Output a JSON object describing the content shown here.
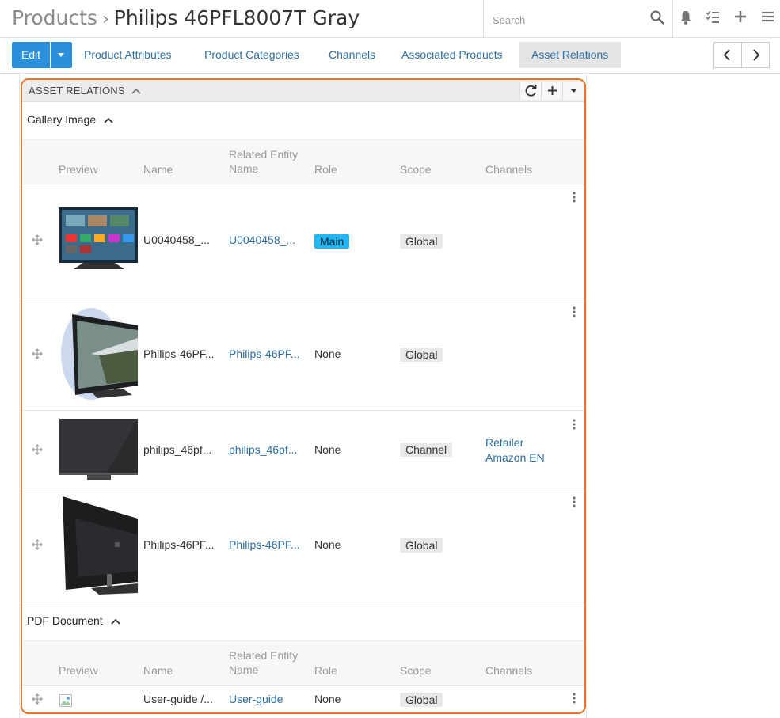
{
  "header": {
    "crumb": "Products",
    "separator": "›",
    "title": "Philips 46PFL8007T Gray",
    "search_placeholder": "Search"
  },
  "toolbar": {
    "edit_label": "Edit",
    "tabs": [
      {
        "label": "Product Attributes"
      },
      {
        "label": "Product Categories"
      },
      {
        "label": "Channels"
      },
      {
        "label": "Associated Products"
      },
      {
        "label": "Asset Relations"
      }
    ]
  },
  "panel": {
    "title": "ASSET RELATIONS",
    "columns": {
      "preview": "Preview",
      "name": "Name",
      "related": "Related Entity Name",
      "role": "Role",
      "scope": "Scope",
      "channels": "Channels"
    },
    "gallery": {
      "title": "Gallery Image",
      "rows": [
        {
          "name": "U0040458_...",
          "related": "U0040458_...",
          "role": "Main",
          "scope": "Global",
          "channels": ""
        },
        {
          "name": "Philips-46PF...",
          "related": "Philips-46PF...",
          "role": "None",
          "scope": "Global",
          "channels": ""
        },
        {
          "name": "philips_46pf...",
          "related": "philips_46pf...",
          "role": "None",
          "scope": "Channel",
          "channels": "Retailer Amazon EN"
        },
        {
          "name": "Philips-46PF...",
          "related": "Philips-46PF...",
          "role": "None",
          "scope": "Global",
          "channels": ""
        }
      ]
    },
    "pdf": {
      "title": "PDF Document",
      "rows": [
        {
          "name": "User-guide /...",
          "related": "User-guide",
          "role": "None",
          "scope": "Global",
          "channels": ""
        }
      ]
    }
  },
  "colors": {
    "accent": "#2c8fdb",
    "highlight": "#ed7320",
    "main_badge": "#23b5f2"
  }
}
